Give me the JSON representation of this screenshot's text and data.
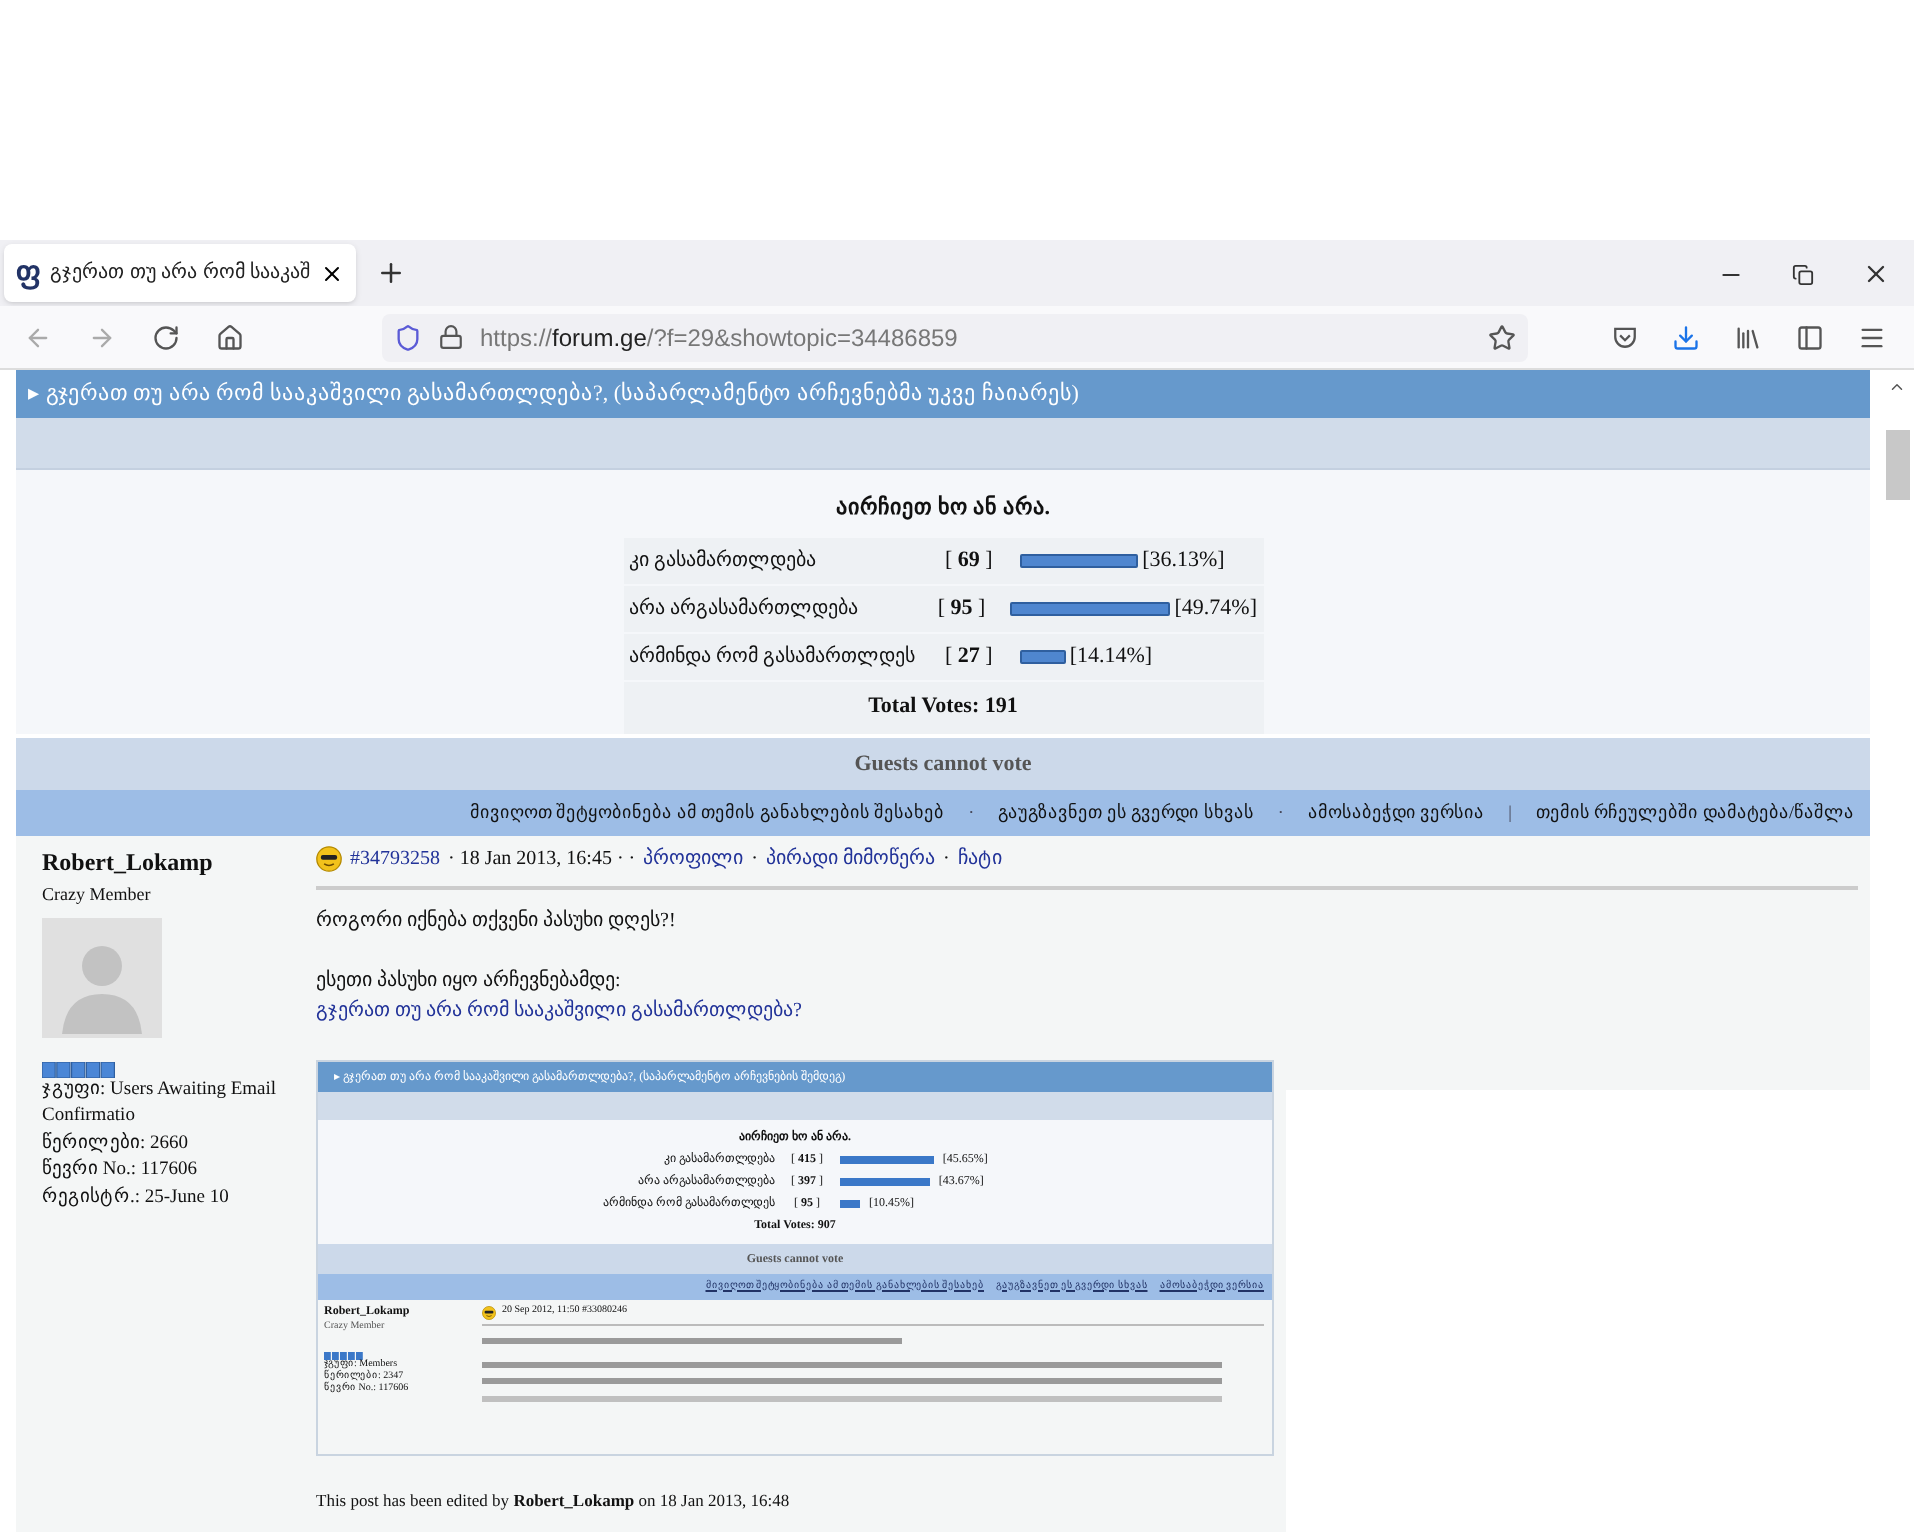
{
  "browser": {
    "tab": {
      "icon_text": "ფ",
      "title": "გჯერათ თუ არა რომ სააკაშ",
      "selected": true
    },
    "url": {
      "scheme": "https://",
      "host": "forum.ge",
      "path": "/?f=29&showtopic=34486859"
    }
  },
  "topic_title": "▸ გჯერათ თუ არა რომ სააკაშვილი გასამართლდება?, (საპარლამენტო არჩევნებმა უკვე ჩაიარეს)",
  "poll": {
    "question": "აირჩიეთ ხო ან არა.",
    "total": "Total Votes: 191",
    "options": [
      {
        "label": "კი გასამართლდება",
        "votes": "[ **69** ]",
        "percent": "[36.13%]"
      },
      {
        "label": "არა არგასამართლდება",
        "votes": "[ **95** ]",
        "percent": "[49.74%]"
      },
      {
        "label": "არმინდა რომ გასამართლდეს",
        "votes": "[ **27** ]",
        "percent": "[14.14%]"
      }
    ]
  },
  "guests_notice": "Guests cannot vote",
  "topic_links": [
    {
      "kind": "link",
      "text": "მივიღოთ შეტყობინება ამ თემის განახლების შესახებ"
    },
    {
      "kind": "separator",
      "text": "·"
    },
    {
      "kind": "link",
      "text": "გაუგზავნეთ ეს გვერდი სხვას"
    },
    {
      "kind": "separator",
      "text": "·"
    },
    {
      "kind": "link",
      "text": "ამოსაბეჭდი ვერსია"
    },
    {
      "kind": "separator",
      "text": "|"
    },
    {
      "kind": "link",
      "text": "თემის რჩეულებში დამატება/წაშლა"
    }
  ],
  "post": {
    "author": "Robert_Lokamp",
    "rank": "Crazy Member",
    "details": [
      "ჯგუფი: Users Awaiting Email Confirmatio",
      "წერილები: 2660",
      "წევრი No.: 117606",
      "რეგისტრ.: 25-June 10"
    ],
    "post_id": "#34793258",
    "date": "· 18 Jan 2013, 16:45 · ·",
    "links": [
      {
        "kind": "link",
        "text": "პროფილი"
      },
      {
        "kind": "separator",
        "text": "·"
      },
      {
        "kind": "link",
        "text": "პირადი მიმოწერა"
      },
      {
        "kind": "separator",
        "text": "·"
      },
      {
        "kind": "link",
        "text": "ჩატი"
      }
    ],
    "body": [
      "როგორი იქნება თქვენი პასუხი დღეს?!",
      "ესეთი პასუხი იყო არჩევნებამდე:"
    ],
    "quote_link": "გჯერათ თუ არა რომ სააკაშვილი გასამართლდება?",
    "screenshot": {
      "title": "▸ გჯერათ თუ არა რომ სააკაშვილი გასამართლდება?, (საპარლამენტო არჩევნების შემდეგ)",
      "question": "აირჩიეთ ხო ან არა.",
      "total": "Total Votes: 907",
      "options": [
        {
          "label": "კი გასამართლდება",
          "votes": "[ **415** ]",
          "percent": "[45.65%]"
        },
        {
          "label": "არა არგასამართლდება",
          "votes": "[ **397** ]",
          "percent": "[43.67%]"
        },
        {
          "label": "არმინდა რომ გასამართლდეს",
          "votes": "[ **95** ]",
          "percent": "[10.45%]"
        }
      ],
      "guests_notice": "Guests cannot vote",
      "links": [
        "მივიღოთ შეტყობინება ამ თემის განახლების შესახებ",
        "გაუგზავნეთ ეს გვერდი სხვას",
        "ამოსაბეჭდი ვერსია"
      ],
      "author": "Robert_Lokamp",
      "rank": "Crazy Member",
      "details": [
        "ჯგუფი: Members",
        "წერილები: 2347",
        "წევრი No.: 117606"
      ],
      "date": "20 Sep 2012, 11:50 #33080246"
    },
    "edited": "This post has been edited by **Robert_Lokamp** on 18 Jan 2013, 16:48"
  }
}
